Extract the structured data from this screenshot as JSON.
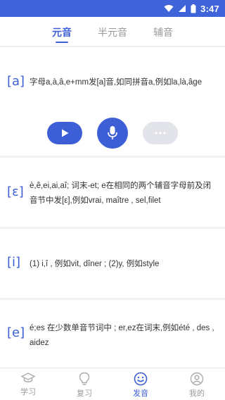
{
  "status_bar": {
    "time": "3:47",
    "icons": [
      "wifi-icon",
      "signal-icon",
      "battery-icon"
    ]
  },
  "tabs": [
    {
      "label": "元音",
      "active": true
    },
    {
      "label": "半元音",
      "active": false
    },
    {
      "label": "辅音",
      "active": false
    }
  ],
  "entries": [
    {
      "symbol": "[a]",
      "description": "字母a,à,â,e+mm发[a]音,如同拼音a,例如la,là,âge"
    },
    {
      "symbol": "[ε]",
      "description": "è,ê,ei,ai,aî; 词末-et; e在相同的两个辅音字母前及闭音节中发[ε],例如vrai, maître , sel,filet"
    },
    {
      "symbol": "[i]",
      "description": "(1) i,î , 例如vit, dîner ; (2)y, 例如style"
    },
    {
      "symbol": "[e]",
      "description": "é;es 在少数单音节词中 ; er,ez在词末,例如été , des , aidez"
    }
  ],
  "controls": {
    "play_icon": "play-icon",
    "mic_icon": "microphone-icon",
    "more_icon": "more-icon"
  },
  "bottom_nav": [
    {
      "label": "学习",
      "icon": "graduation-cap-icon",
      "active": false
    },
    {
      "label": "复习",
      "icon": "lightbulb-icon",
      "active": false
    },
    {
      "label": "发音",
      "icon": "smile-face-icon",
      "active": true
    },
    {
      "label": "我的",
      "icon": "user-icon",
      "active": false
    }
  ],
  "colors": {
    "accent": "#3d5fd6",
    "status_bar": "#3f63d8",
    "inactive": "#9a9a9a",
    "background": "#f2f2f2"
  }
}
